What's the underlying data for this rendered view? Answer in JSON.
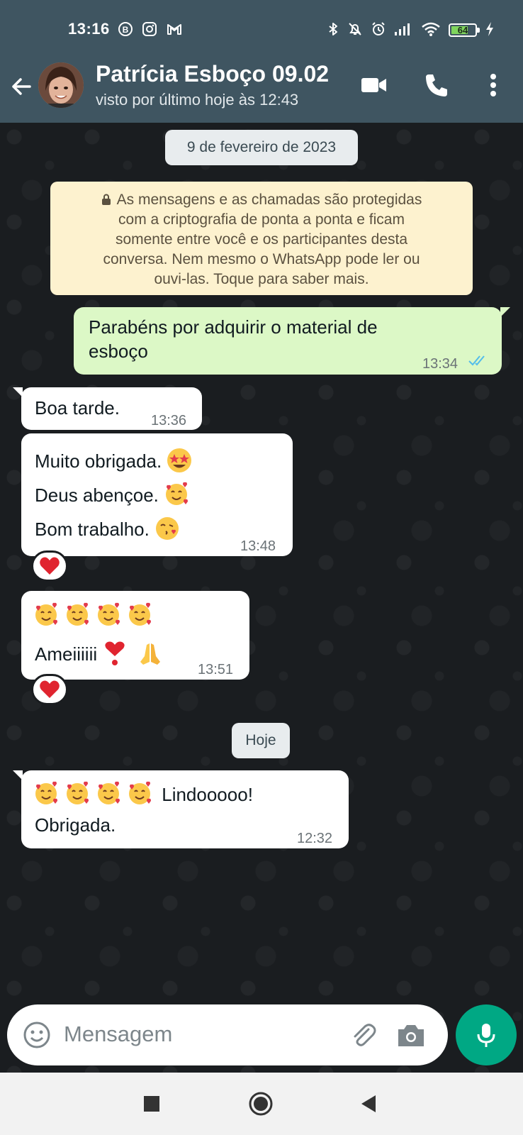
{
  "status_bar": {
    "time": "13:16",
    "battery": "64",
    "left_icons": [
      "bold-b-icon",
      "instagram-icon",
      "gmail-icon"
    ],
    "right_icons": [
      "bluetooth-icon",
      "bell-off-icon",
      "alarm-icon",
      "signal-icon",
      "wifi-icon",
      "battery-icon",
      "charging-icon"
    ]
  },
  "header": {
    "contact_name": "Patrícia Esboço 09.02",
    "last_seen": "visto por último hoje às 12:43",
    "icons": [
      "back-arrow-icon",
      "video-call-icon",
      "phone-icon",
      "more-vert-icon"
    ]
  },
  "chat": {
    "date_chip_1": "9 de fevereiro de 2023",
    "encryption_notice": {
      "lines": [
        "As mensagens e as chamadas são protegidas",
        "com a criptografia de ponta a ponta e ficam",
        "somente entre você e os participantes desta",
        "conversa. Nem mesmo o WhatsApp pode ler ou",
        "ouvi-las. Toque para saber mais."
      ]
    },
    "messages": [
      {
        "direction": "outgoing",
        "lines": [
          "Parabéns por adquirir o material de",
          "esboço"
        ],
        "time": "13:34",
        "status": "read"
      },
      {
        "direction": "incoming",
        "lines": [
          "Boa tarde."
        ],
        "time": "13:36"
      },
      {
        "direction": "incoming",
        "lines": [
          "Muito obrigada.",
          "Deus abençoe.",
          "Bom trabalho."
        ],
        "emojis": [
          "star-struck",
          "smiling-face-with-hearts",
          "face-blowing-kiss"
        ],
        "time": "13:48",
        "reaction": "red-heart"
      },
      {
        "direction": "incoming",
        "lines": [
          "",
          "Ameiiiiii"
        ],
        "emojis": [
          "smiling-face-with-hearts x4",
          "heart-exclamation",
          "folded-hands"
        ],
        "time": "13:51",
        "reaction": "red-heart"
      }
    ],
    "date_chip_2": "Hoje",
    "last_message": {
      "direction": "incoming",
      "lines": [
        "Lindooooo!",
        "Obrigada."
      ],
      "emojis": [
        "smiling-face-with-hearts x4"
      ],
      "time": "12:32"
    }
  },
  "input": {
    "placeholder": "Mensagem",
    "icons": [
      "emoji-icon",
      "attach-icon",
      "camera-icon",
      "mic-icon"
    ]
  },
  "nav_bar": {
    "icons": [
      "recents-square-icon",
      "home-circle-icon",
      "back-triangle-icon"
    ]
  },
  "colors": {
    "header_bg": "#3f5561",
    "outgoing_bubble": "#dcf8c6",
    "incoming_bubble": "#ffffff",
    "notice_bg": "#fdf2cf",
    "accent_green": "#00a884",
    "read_tick": "#53bdeb"
  }
}
